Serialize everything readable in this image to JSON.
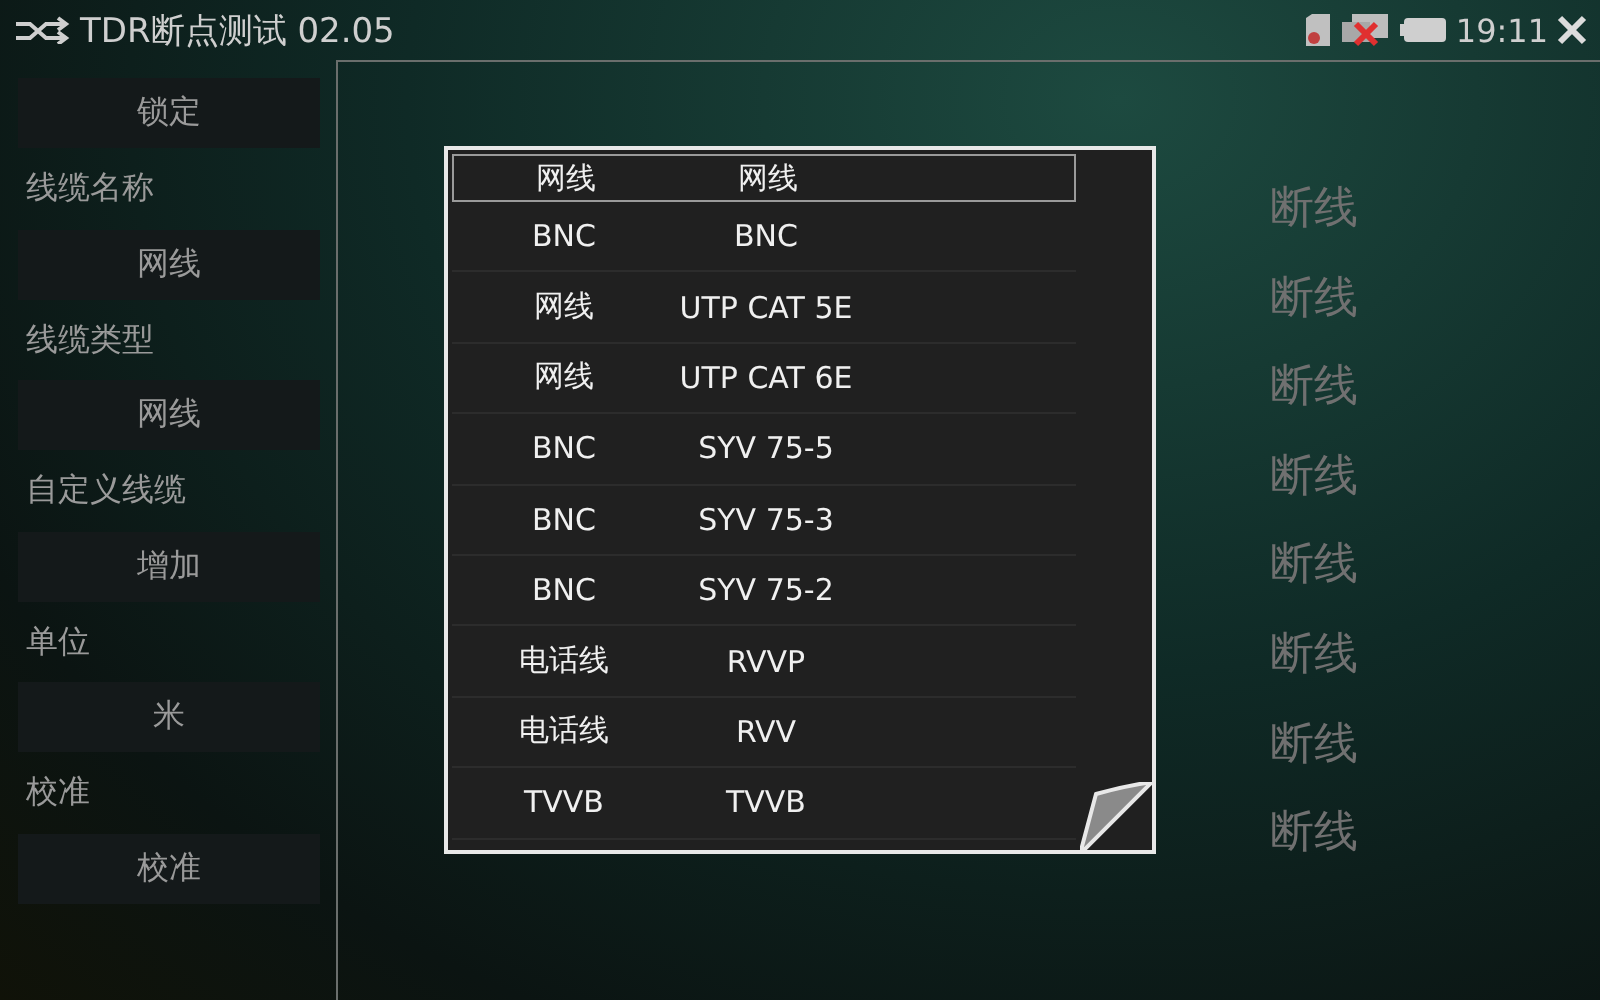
{
  "title_bar": {
    "title": "TDR断点测试 02.05",
    "time": "19:11"
  },
  "sidebar": [
    {
      "kind": "button",
      "text": "锁定"
    },
    {
      "kind": "label",
      "text": "线缆名称"
    },
    {
      "kind": "button",
      "text": "网线"
    },
    {
      "kind": "label",
      "text": "线缆类型"
    },
    {
      "kind": "button",
      "text": "网线"
    },
    {
      "kind": "label",
      "text": "自定义线缆"
    },
    {
      "kind": "button",
      "text": "增加"
    },
    {
      "kind": "label",
      "text": "单位"
    },
    {
      "kind": "button",
      "text": "米"
    },
    {
      "kind": "label",
      "text": "校准"
    },
    {
      "kind": "button",
      "text": "校准"
    }
  ],
  "cable_list": [
    {
      "name": "网线",
      "type": "网线",
      "selected": true
    },
    {
      "name": "BNC",
      "type": "BNC",
      "selected": false
    },
    {
      "name": "网线",
      "type": "UTP CAT 5E",
      "selected": false
    },
    {
      "name": "网线",
      "type": "UTP CAT 6E",
      "selected": false
    },
    {
      "name": "BNC",
      "type": "SYV 75-5",
      "selected": false
    },
    {
      "name": "BNC",
      "type": "SYV 75-3",
      "selected": false
    },
    {
      "name": "BNC",
      "type": "SYV 75-2",
      "selected": false
    },
    {
      "name": "电话线",
      "type": "RVVP",
      "selected": false
    },
    {
      "name": "电话线",
      "type": "RVV",
      "selected": false
    },
    {
      "name": "TVVB",
      "type": "TVVB",
      "selected": false
    }
  ],
  "results": [
    "断线",
    "断线",
    "断线",
    "断线",
    "断线",
    "断线",
    "断线",
    "断线"
  ]
}
